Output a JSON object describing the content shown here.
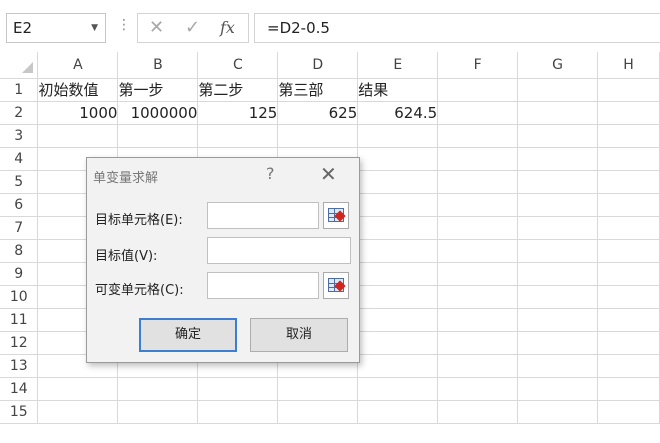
{
  "formula_bar": {
    "name_box": "E2",
    "separator": "⋮",
    "cancel_icon": "close-icon",
    "confirm_icon": "check-icon",
    "function_icon": "fx",
    "formula": "=D2-0.5"
  },
  "sheet": {
    "columns": [
      "A",
      "B",
      "C",
      "D",
      "E",
      "F",
      "G",
      "H"
    ],
    "rows": [
      "1",
      "2",
      "3",
      "4",
      "5",
      "6",
      "7",
      "8",
      "9",
      "10",
      "11",
      "12",
      "13",
      "14",
      "15"
    ],
    "row1": [
      "初始数值",
      "第一步",
      "第二步",
      "第三部",
      "结果"
    ],
    "row2": [
      "1000",
      "1000000",
      "125",
      "625",
      "624.5"
    ]
  },
  "dialog": {
    "title": "单变量求解",
    "help": "?",
    "close": "✕",
    "set_cell_label": "目标单元格(E):",
    "set_cell_value": "",
    "to_value_label": "目标值(V):",
    "to_value_value": "",
    "changing_cell_label": "可变单元格(C):",
    "changing_cell_value": "",
    "ok_label": "确定",
    "cancel_label": "取消"
  }
}
